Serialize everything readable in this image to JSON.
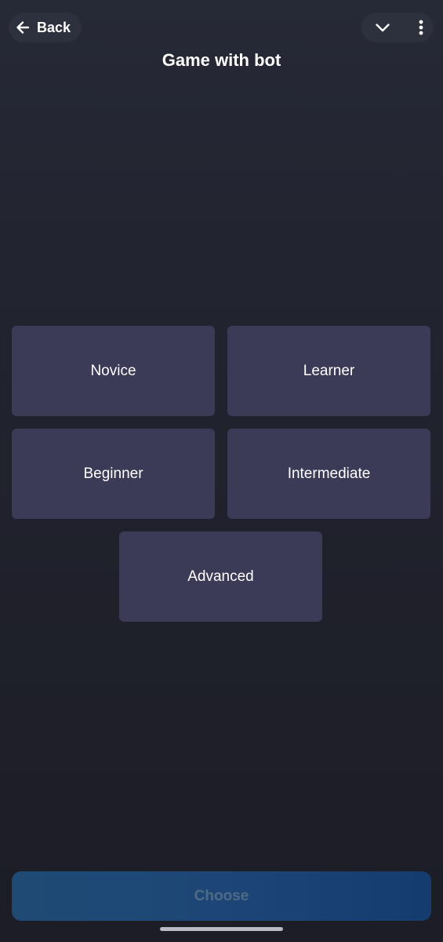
{
  "header": {
    "back_label": "Back",
    "title": "Game with bot",
    "icons": {
      "back": "arrow-left-icon",
      "collapse": "chevron-down-icon",
      "more": "more-vertical-icon"
    }
  },
  "levels": [
    {
      "label": "Novice"
    },
    {
      "label": "Learner"
    },
    {
      "label": "Beginner"
    },
    {
      "label": "Intermediate"
    },
    {
      "label": "Advanced"
    }
  ],
  "footer": {
    "choose_label": "Choose",
    "choose_enabled": false
  },
  "colors": {
    "background": "#21232e",
    "level_button": "#3b3a57",
    "choose_button": "#1d4676",
    "choose_text_disabled": "#4f6a86"
  }
}
